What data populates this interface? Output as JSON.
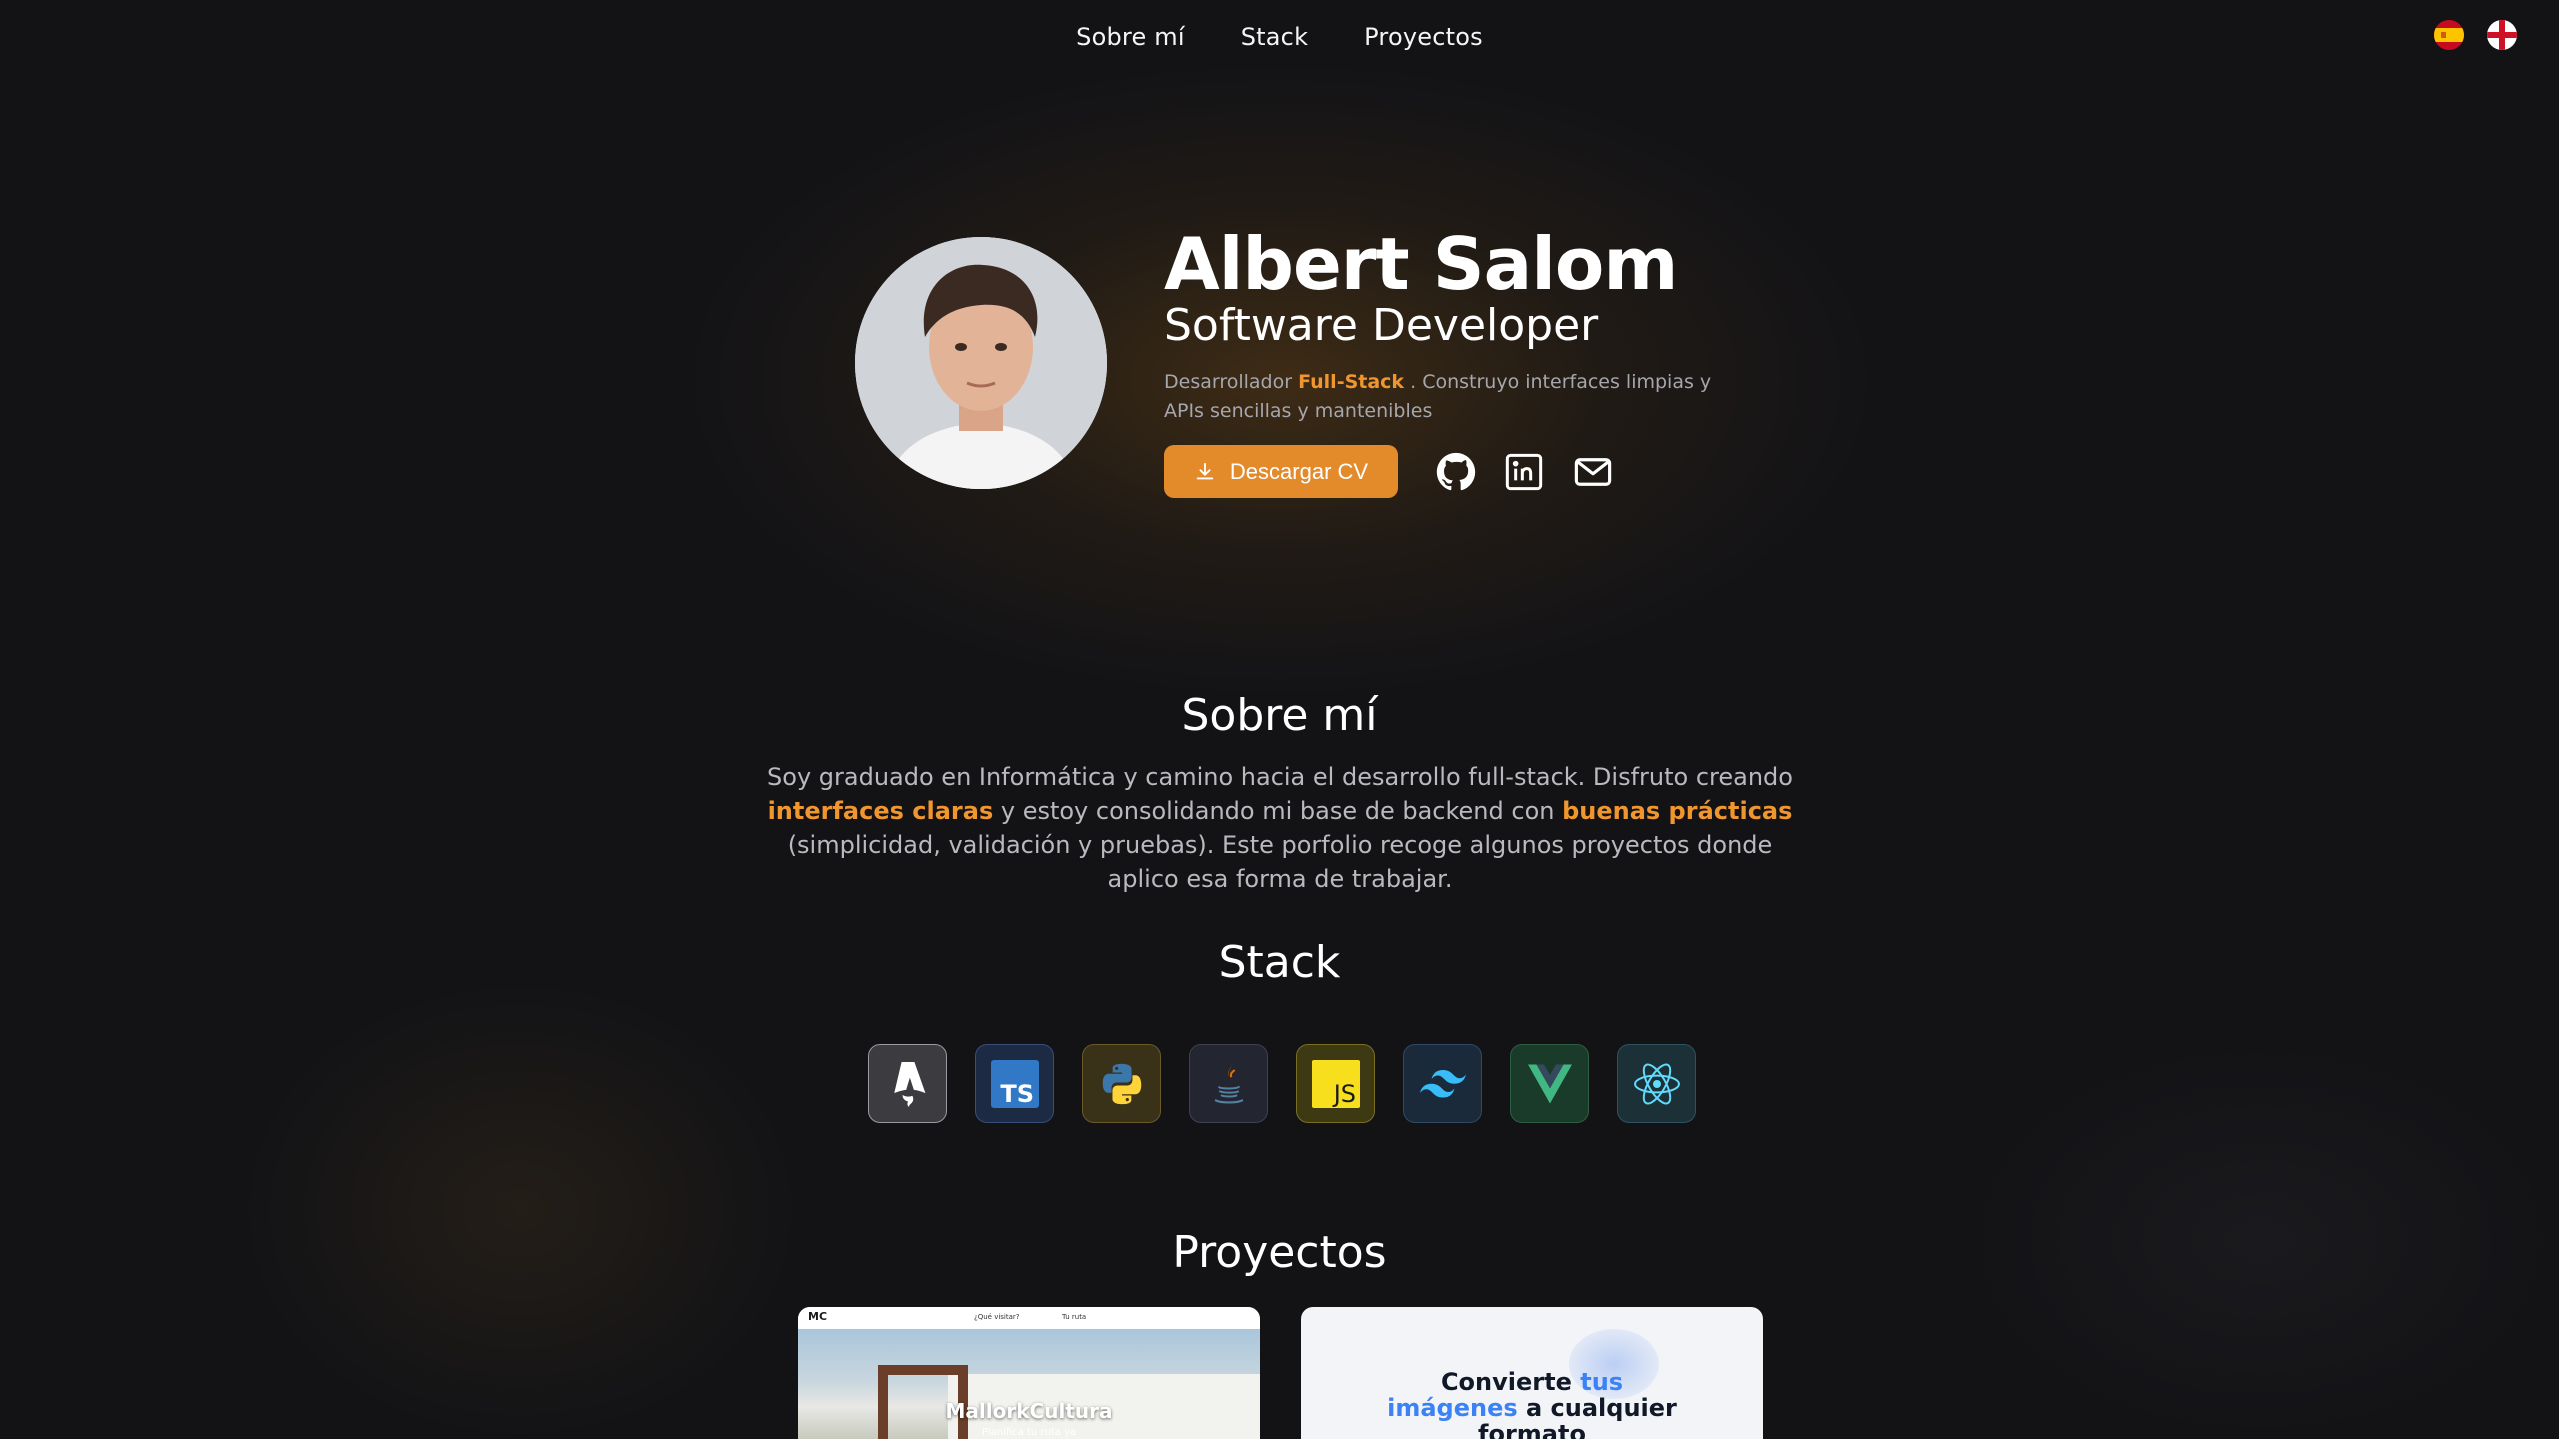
{
  "nav": {
    "links": [
      "Sobre mí",
      "Stack",
      "Proyectos"
    ],
    "lang_es_icon": "spain-flag-icon",
    "lang_en_icon": "england-flag-icon"
  },
  "hero": {
    "name": "Albert Salom",
    "role": "Software Developer",
    "bio_pre": "Desarrollador ",
    "bio_highlight": "Full-Stack",
    "bio_post": " . Construyo interfaces limpias y APIs sencillas y mantenibles",
    "cv_button": "Descargar CV",
    "accent_color": "#e38a2b",
    "socials": [
      "github-icon",
      "linkedin-icon",
      "mail-icon"
    ]
  },
  "about": {
    "title": "Sobre mí",
    "text_1": "Soy graduado en Informática y camino hacia el desarrollo full-stack. Disfruto creando ",
    "hl_1": "interfaces claras",
    "text_2": " y estoy consolidando mi base de backend con ",
    "hl_2": "buenas prácticas",
    "text_3": " (simplicidad, validación y pruebas). Este porfolio recoge algunos proyectos donde aplico esa forma de trabajar."
  },
  "stack": {
    "title": "Stack",
    "items": [
      {
        "icon": "astro-icon"
      },
      {
        "icon": "typescript-icon",
        "label": "TS"
      },
      {
        "icon": "python-icon"
      },
      {
        "icon": "java-icon"
      },
      {
        "icon": "javascript-icon",
        "label": "JS"
      },
      {
        "icon": "tailwind-icon"
      },
      {
        "icon": "vue-icon"
      },
      {
        "icon": "react-icon"
      }
    ]
  },
  "projects": {
    "title": "Proyectos",
    "cards": [
      {
        "title": "MallorkCultura",
        "logo": "MC",
        "nav_1": "¿Qué visitar?",
        "nav_2": "Tu ruta",
        "subtitle": "Planifica tu ruta ya"
      },
      {
        "title_1": "Convierte ",
        "title_blue_1": "tus",
        "title_blue_2": "imágenes",
        "title_2": " a cualquier",
        "title_3": "formato"
      }
    ]
  }
}
